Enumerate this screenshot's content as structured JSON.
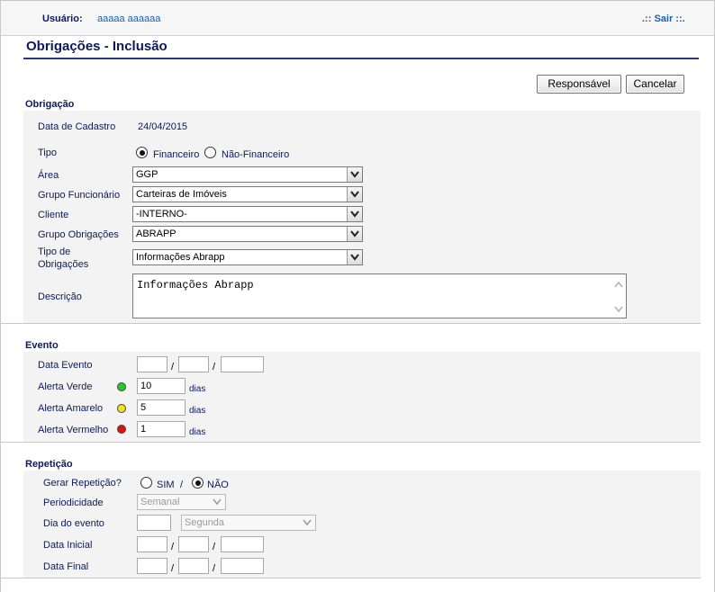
{
  "header": {
    "user_label": "Usuário:",
    "user_name": "aaaaa aaaaaa",
    "logout_label": ".:: Sair ::."
  },
  "page": {
    "title": "Obrigações - Inclusão"
  },
  "toolbar": {
    "responsible_label": "Responsável",
    "cancel_label": "Cancelar"
  },
  "obrigacao": {
    "section_title": "Obrigação",
    "data_cadastro_label": "Data de Cadastro",
    "data_cadastro_value": "24/04/2015",
    "tipo_label": "Tipo",
    "tipo_options": [
      "Financeiro",
      "Não-Financeiro"
    ],
    "tipo_selected": "Financeiro",
    "area_label": "Área",
    "area_value": "GGP",
    "grupo_funcionario_label": "Grupo Funcionário",
    "grupo_funcionario_value": "Carteiras de Imóveis",
    "cliente_label": "Cliente",
    "cliente_value": "-INTERNO-",
    "grupo_obrigacoes_label": "Grupo Obrigações",
    "grupo_obrigacoes_value": "ABRAPP",
    "tipo_obrigacoes_label_line1": "Tipo de",
    "tipo_obrigacoes_label_line2": "Obrigações",
    "tipo_obrigacoes_value": "Informações Abrapp",
    "descricao_label": "Descrição",
    "descricao_value": "Informações Abrapp"
  },
  "evento": {
    "section_title": "Evento",
    "data_evento_label": "Data Evento",
    "date_separator": "/",
    "alerta_verde_label": "Alerta Verde",
    "alerta_verde_value": "10",
    "alerta_amarelo_label": "Alerta Amarelo",
    "alerta_amarelo_value": "5",
    "alerta_vermelho_label": "Alerta Vermelho",
    "alerta_vermelho_value": "1",
    "dias_label": "dias",
    "colors": {
      "verde": "#22cc22",
      "amarelo": "#f2e21a",
      "vermelho": "#e01010"
    }
  },
  "repeticao": {
    "section_title": "Repetição",
    "gerar_label": "Gerar Repetição?",
    "sim_label": "SIM",
    "separator": "/",
    "nao_label": "NÃO",
    "selected": "NÃO",
    "periodicidade_label": "Periodicidade",
    "periodicidade_value": "Semanal",
    "dia_evento_label": "Dia do evento",
    "dia_semana_value": "Segunda",
    "data_inicial_label": "Data Inicial",
    "data_final_label": "Data Final"
  }
}
